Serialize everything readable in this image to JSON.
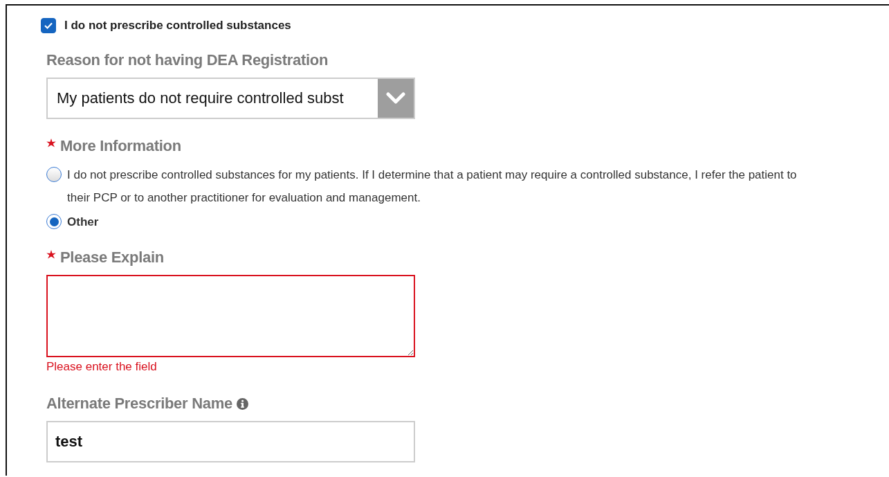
{
  "checkbox": {
    "label": "I do not prescribe controlled substances",
    "checked": true
  },
  "reason": {
    "label": "Reason for not having DEA Registration",
    "value": "My patients do not require controlled subst"
  },
  "more_information": {
    "label": "More Information",
    "required": true,
    "options": [
      {
        "label": "I do not prescribe controlled substances for my patients. If I determine that a patient may require a controlled substance, I refer the patient to their PCP or to another practitioner for evaluation and management.",
        "selected": false
      },
      {
        "label": "Other",
        "selected": true
      }
    ]
  },
  "explain": {
    "label": "Please Explain",
    "required": true,
    "invalid": true,
    "error": "Please enter the field"
  },
  "alternate_prescriber": {
    "label": "Alternate Prescriber Name",
    "value": "test"
  }
}
